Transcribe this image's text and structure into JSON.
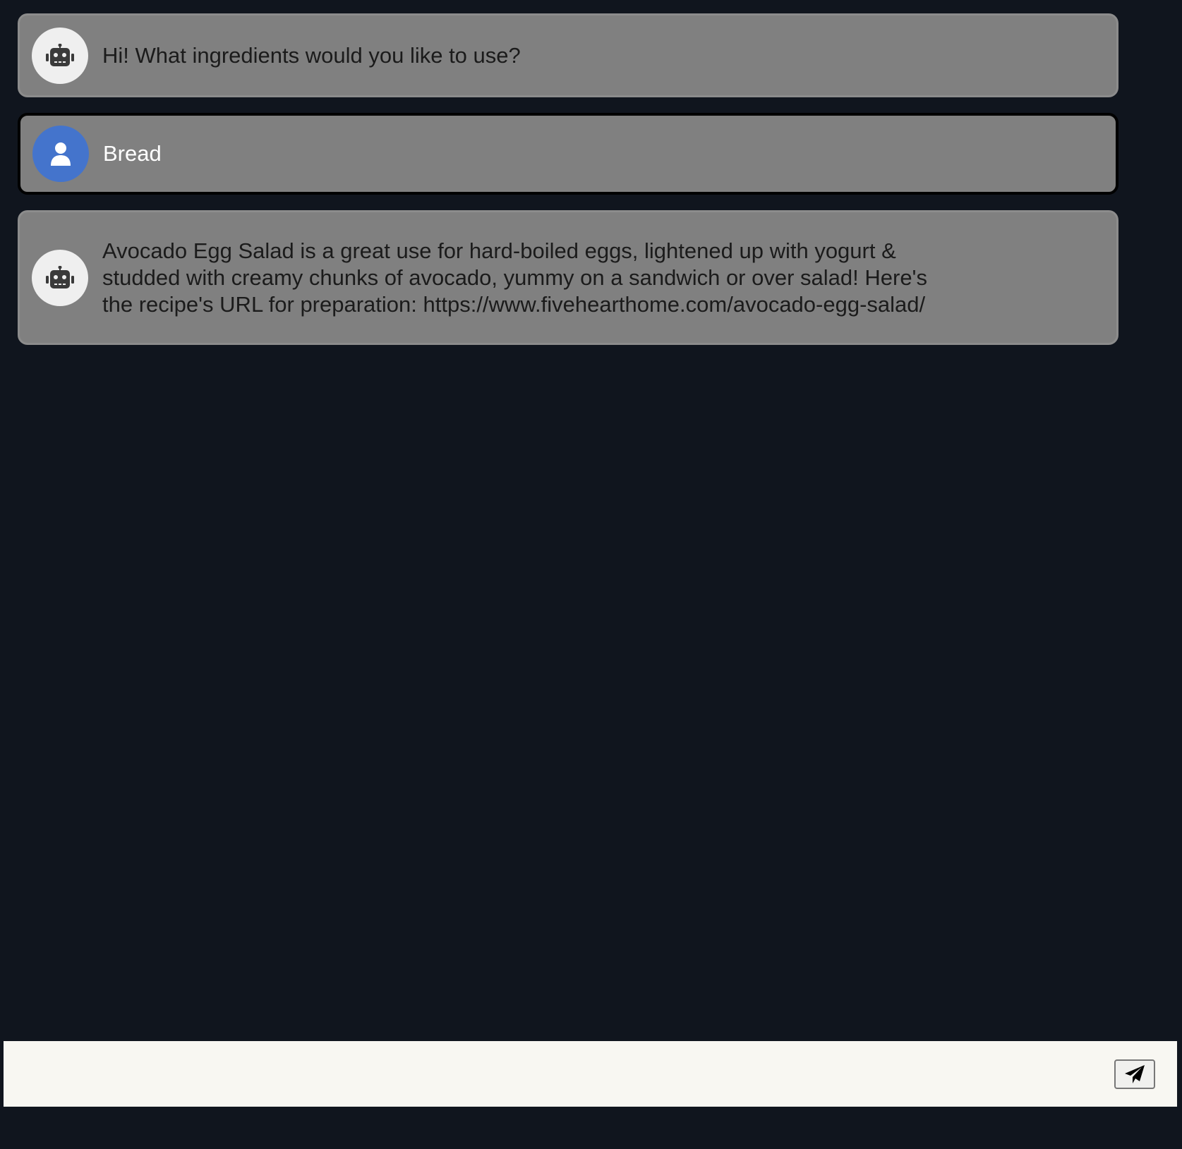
{
  "messages": [
    {
      "role": "bot",
      "icon": "robot-icon",
      "text": "Hi! What ingredients would you like to use?"
    },
    {
      "role": "user",
      "icon": "user-icon",
      "text": "Bread"
    },
    {
      "role": "bot",
      "icon": "robot-icon",
      "text": "Avocado Egg Salad is a great use for hard-boiled eggs, lightened up with yogurt & studded with creamy chunks of avocado, yummy on a sandwich or over salad! Here's the recipe's URL for preparation: https://www.fivehearthome.com/avocado-egg-salad/"
    }
  ],
  "composer": {
    "value": "",
    "placeholder": "",
    "send_icon": "paper-plane-icon"
  },
  "colors": {
    "background": "#10151e",
    "message_bg": "#808080",
    "user_avatar": "#4474cc",
    "bot_avatar": "#efefef",
    "input_bg": "#f8f7f2"
  }
}
